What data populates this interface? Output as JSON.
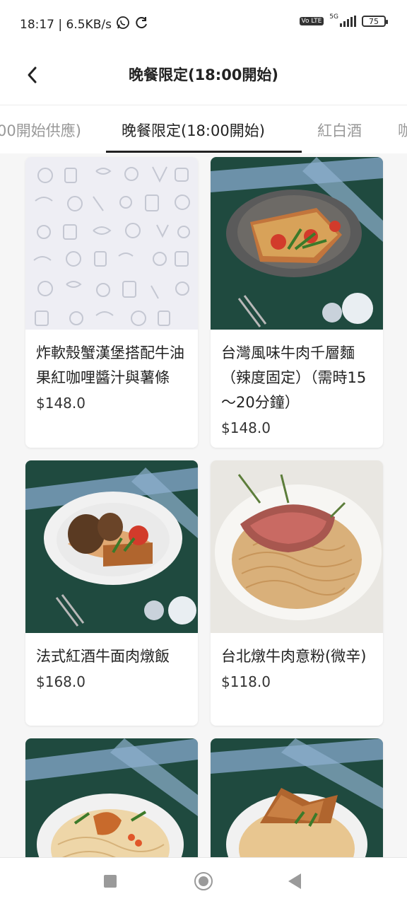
{
  "status_bar": {
    "time_speed": "18:17 | 6.5KB/s",
    "network": "5G",
    "volte": "Vo LTE",
    "battery": "75"
  },
  "header": {
    "title": "晚餐限定(18:00開始)"
  },
  "tabs": [
    {
      "label": "00開始供應)"
    },
    {
      "label": "晚餐限定(18:00開始)"
    },
    {
      "label": "紅白酒"
    },
    {
      "label": "咖"
    }
  ],
  "active_tab": "晚餐限定(18:00開始)",
  "menu_items": [
    {
      "name": "炸軟殼蟹漢堡搭配牛油果紅咖哩醬汁與薯條",
      "price": "$148.0"
    },
    {
      "name": "台灣風味牛肉千層麵（辣度固定）（需時15～20分鐘）",
      "price": "$148.0"
    },
    {
      "name": "法式紅酒牛面肉燉飯",
      "price": "$168.0"
    },
    {
      "name": "台北燉牛肉意粉(微辛)",
      "price": "$118.0"
    },
    {
      "name": "",
      "price": ""
    },
    {
      "name": "",
      "price": ""
    }
  ],
  "colors": {
    "accent": "#222222",
    "background": "#f6f6f6",
    "tab_inactive": "#999999",
    "plate_bg": "#1e4a3d",
    "ribbon": "#7fa3c4"
  }
}
